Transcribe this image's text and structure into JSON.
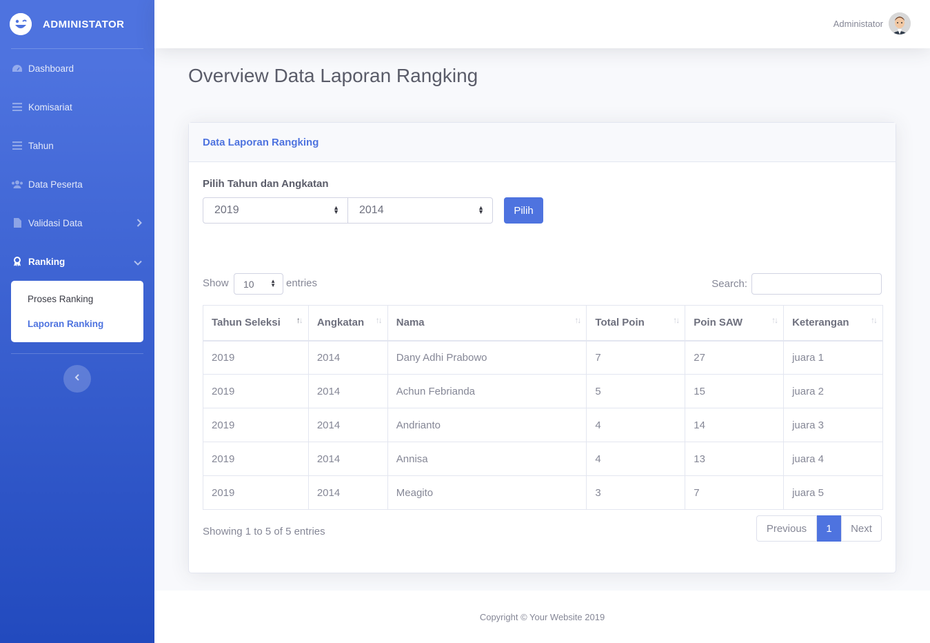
{
  "brand": {
    "title": "ADMINISTATOR"
  },
  "sidebar": {
    "items": [
      {
        "label": "Dashboard",
        "icon": "tachometer-icon"
      },
      {
        "label": "Komisariat",
        "icon": "list-icon"
      },
      {
        "label": "Tahun",
        "icon": "list-icon"
      },
      {
        "label": "Data Peserta",
        "icon": "users-icon"
      },
      {
        "label": "Validasi Data",
        "icon": "file-icon"
      },
      {
        "label": "Ranking",
        "icon": "award-icon"
      }
    ],
    "submenu": [
      {
        "label": "Proses Ranking"
      },
      {
        "label": "Laporan Ranking"
      }
    ]
  },
  "topbar": {
    "user_name": "Administator"
  },
  "page": {
    "title": "Overview Data Laporan Rangking"
  },
  "card": {
    "title": "Data Laporan Rangking",
    "pick_label": "Pilih Tahun dan Angkatan",
    "year_select": "2019",
    "angkatan_select": "2014",
    "button": "Pilih"
  },
  "table_controls": {
    "show": "Show",
    "length": "10",
    "entries": "entries",
    "search": "Search:"
  },
  "table": {
    "headers": [
      "Tahun Seleksi",
      "Angkatan",
      "Nama",
      "Total Poin",
      "Poin SAW",
      "Keterangan"
    ],
    "rows": [
      [
        "2019",
        "2014",
        "Dany Adhi Prabowo",
        "7",
        "27",
        "juara 1"
      ],
      [
        "2019",
        "2014",
        "Achun Febrianda",
        "5",
        "15",
        "juara 2"
      ],
      [
        "2019",
        "2014",
        "Andrianto",
        "4",
        "14",
        "juara 3"
      ],
      [
        "2019",
        "2014",
        "Annisa",
        "4",
        "13",
        "juara 4"
      ],
      [
        "2019",
        "2014",
        "Meagito",
        "3",
        "7",
        "juara 5"
      ]
    ]
  },
  "pagination": {
    "info": "Showing 1 to 5 of 5 entries",
    "previous": "Previous",
    "current": "1",
    "next": "Next"
  },
  "footer": {
    "copyright": "Copyright © Your Website 2019"
  },
  "colors": {
    "primary": "#4e73df",
    "sidebar_end": "#224abe"
  }
}
